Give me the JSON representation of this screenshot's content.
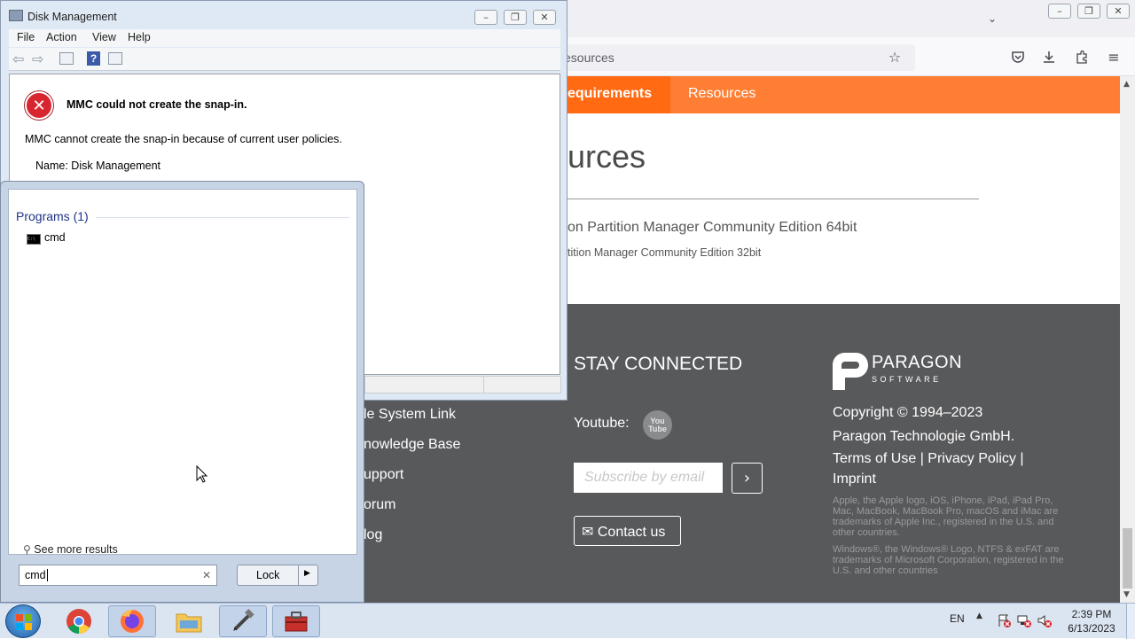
{
  "browser": {
    "url_fragment": "esources",
    "nav": {
      "active_label": "equirements",
      "resources_label": "Resources"
    },
    "page_heading": "urces",
    "download_64": "on Partition Manager Community Edition 64bit",
    "download_32": "tition Manager Community Edition 32bit",
    "footer": {
      "left_links": [
        "le System Link",
        "nowledge Base",
        "upport",
        "orum",
        "log"
      ],
      "stay_connected": "STAY CONNECTED",
      "youtube_label": "Youtube:",
      "youtube_icon_text": "You\nTube",
      "subscribe_placeholder": "Subscribe by email",
      "contact_label": "Contact us",
      "logo_name": "PARAGON",
      "logo_sub": "SOFTWARE",
      "copyright": "Copyright © 1994–2023",
      "company": "Paragon Technologie GmbH.",
      "legal_links": "Terms of Use | Privacy Policy |",
      "imprint": "Imprint",
      "apple_notice": "Apple, the Apple logo, iOS, iPhone, iPad, iPad Pro, Mac, MacBook, MacBook Pro, macOS and iMac are trademarks of Apple Inc., registered in the U.S. and other countries.",
      "windows_notice": "Windows®, the Windows® Logo, NTFS & exFAT are trademarks of Microsoft Corporation, registered in the U.S. and other countries"
    }
  },
  "disk_management": {
    "title": "Disk Management",
    "menu": [
      "File",
      "Action",
      "View",
      "Help"
    ],
    "error_title": "MMC could not create the snap-in.",
    "error_message": "MMC cannot create the snap-in because of current user policies.",
    "error_name": "Name: Disk Management"
  },
  "start_menu": {
    "programs_header": "Programs (1)",
    "program_item": "cmd",
    "see_more": "See more results",
    "search_value": "cmd",
    "lock_label": "Lock"
  },
  "taskbar": {
    "language": "EN",
    "time": "2:39 PM",
    "date": "6/13/2023"
  },
  "colors": {
    "accent_orange": "#ff7e33",
    "footer_gray": "#58595b",
    "win7_frame": "#dfe9f5"
  }
}
